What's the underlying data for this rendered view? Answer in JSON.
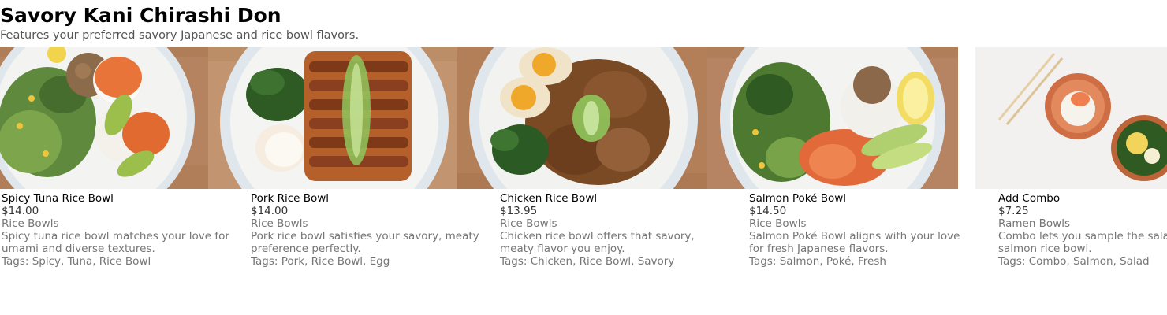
{
  "header": {
    "title": "Savory Kani Chirashi Don",
    "subtitle": "Features your preferred savory Japanese and rice bowl flavors."
  },
  "items": [
    {
      "name": "Spicy Tuna Rice Bowl",
      "price": "$14.00",
      "category": "Rice Bowls",
      "description": "Spicy tuna rice bowl matches your love for umami and diverse textures.",
      "tags": "Tags: Spicy, Tuna, Rice Bowl"
    },
    {
      "name": "Pork Rice Bowl",
      "price": "$14.00",
      "category": "Rice Bowls",
      "description": "Pork rice bowl satisfies your savory, meaty preference perfectly.",
      "tags": "Tags: Pork, Rice Bowl, Egg"
    },
    {
      "name": "Chicken Rice Bowl",
      "price": "$13.95",
      "category": "Rice Bowls",
      "description": "Chicken rice bowl offers that savory, meaty flavor you enjoy.",
      "tags": "Tags: Chicken, Rice Bowl, Savory"
    },
    {
      "name": "Salmon Poké Bowl",
      "price": "$14.50",
      "category": "Rice Bowls",
      "description": "Salmon Poké Bowl aligns with your love for fresh Japanese flavors.",
      "tags": "Tags: Salmon, Poké, Fresh"
    },
    {
      "name": "Add Combo",
      "price": "$7.25",
      "category": "Ramen Bowls",
      "description": "Combo lets you sample the salad and mini salmon rice bowl.",
      "tags": "Tags: Combo, Salmon, Salad"
    }
  ],
  "colors": {
    "wood_background": "#b58360",
    "plate": "#e4ebef",
    "marble_background": "#f3f1f0"
  }
}
